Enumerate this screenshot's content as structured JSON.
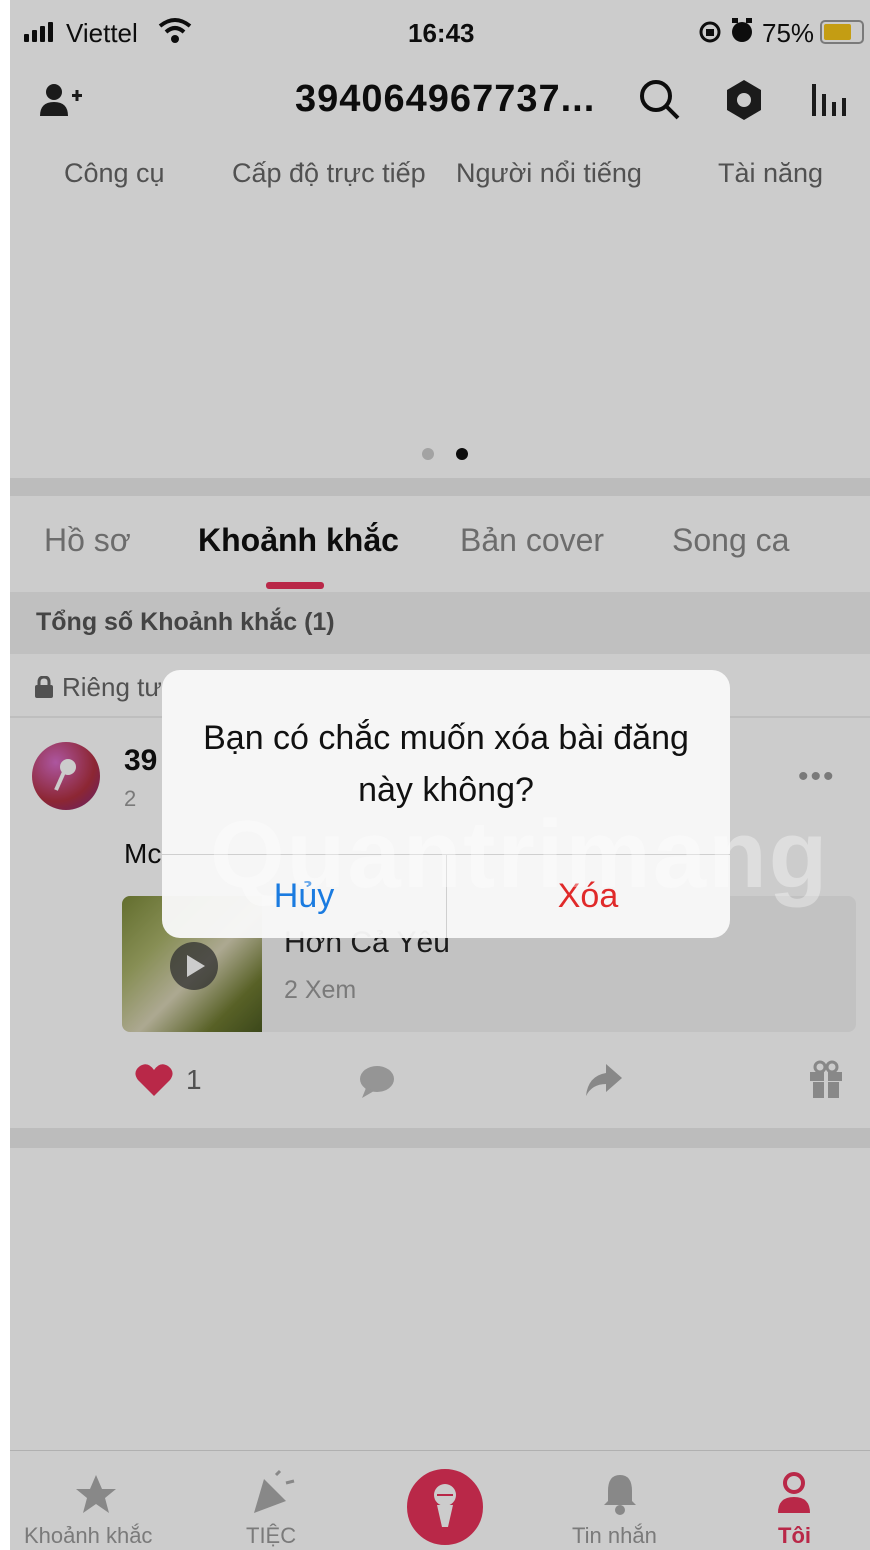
{
  "status_bar": {
    "carrier": "Viettel",
    "time": "16:43",
    "battery": "75%",
    "battery_level": 0.75
  },
  "header": {
    "title": "394064967737..."
  },
  "tools": {
    "items": [
      {
        "label": "Công cụ"
      },
      {
        "label": "Cấp độ trực tiếp"
      },
      {
        "label": "Người nổi tiếng"
      },
      {
        "label": "Tài năng"
      }
    ],
    "page_count": 2,
    "active_page": 2
  },
  "tabs": [
    {
      "label": "Hồ sơ",
      "active": false
    },
    {
      "label": "Khoảnh khắc",
      "active": true
    },
    {
      "label": "Bản cover",
      "active": false
    },
    {
      "label": "Song ca",
      "active": false
    }
  ],
  "moments": {
    "count_label": "Tổng số Khoảnh khắc (1)",
    "privacy_label": "Riêng tư"
  },
  "post": {
    "username": "39",
    "subline": "2",
    "caption": "Mc",
    "song": {
      "title": "Hơn Cả Yêu",
      "views": "2 Xem"
    },
    "likes": "1"
  },
  "dialog": {
    "message": "Bạn có chắc muốn xóa bài đăng này không?",
    "cancel_label": "Hủy",
    "delete_label": "Xóa"
  },
  "bottom_nav": {
    "items": [
      {
        "label": "Khoảnh khắc",
        "icon": "star-icon"
      },
      {
        "label": "TIỆC",
        "icon": "party-popper-icon"
      },
      {
        "label": "",
        "icon": "microphone-icon"
      },
      {
        "label": "Tin nhắn",
        "icon": "bell-icon"
      },
      {
        "label": "Tôi",
        "icon": "person-icon"
      }
    ]
  },
  "watermark": "Quantrimang",
  "colors": {
    "accent": "#e8335a",
    "cancel": "#1a7be0",
    "delete": "#e02a2a"
  }
}
